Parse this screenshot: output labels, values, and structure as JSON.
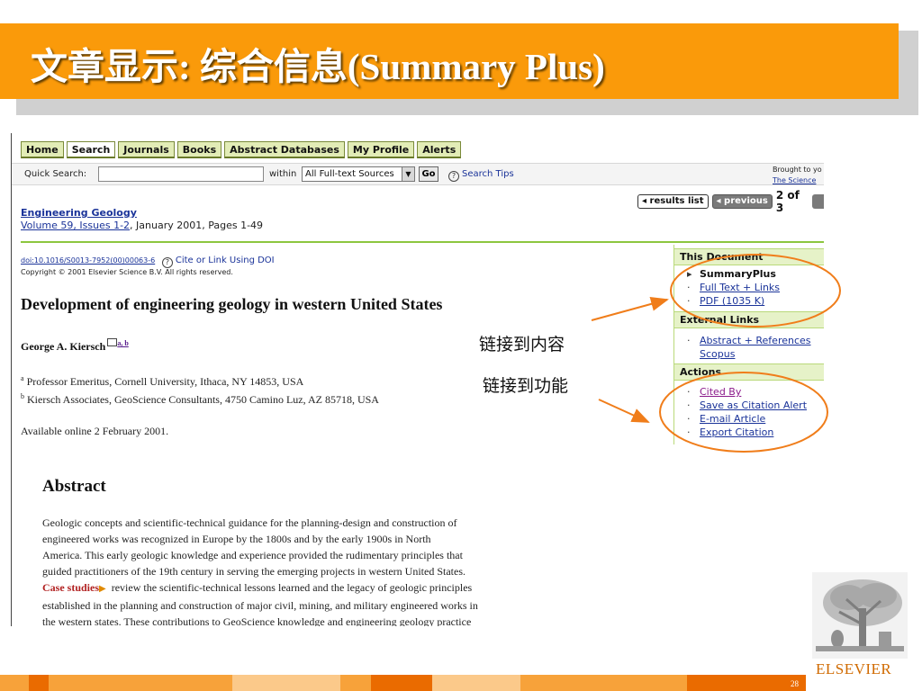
{
  "slide": {
    "title": "文章显示: 综合信息(Summary Plus)",
    "page_number": "28",
    "logo_text": "ELSEVIER"
  },
  "nav": {
    "tabs": [
      "Home",
      "Search",
      "Journals",
      "Books",
      "Abstract Databases",
      "My Profile",
      "Alerts"
    ]
  },
  "search": {
    "quick_label": "Quick Search:",
    "quick_value": "",
    "within_label": "within",
    "source_selected": "All Full-text Sources",
    "go_label": "Go",
    "tips_label": "Search Tips",
    "brought_line1": "Brought to yo",
    "brought_line2": "The Science"
  },
  "pager": {
    "results_list": "results list",
    "previous": "previous",
    "count": "2 of 3"
  },
  "article": {
    "journal": "Engineering Geology",
    "volume_link": "Volume 59, Issues 1-2",
    "volume_rest": ", January 2001, Pages 1-49",
    "doi": "doi:10.1016/S0013-7952(00)00063-6",
    "cite_doi": "Cite or Link Using DOI",
    "copyright": "Copyright © 2001 Elsevier Science B.V. All rights reserved.",
    "title": "Development of engineering geology in western United States",
    "author": "George A. Kiersch",
    "author_refs": "a, b",
    "affiliations": [
      {
        "sup": "a",
        "text": "Professor Emeritus, Cornell University, Ithaca, NY 14853, USA"
      },
      {
        "sup": "b",
        "text": "Kiersch Associates, GeoScience Consultants, 4750 Camino Luz, AZ 85718, USA"
      }
    ],
    "available": "Available online 2 February 2001.",
    "abstract_heading": "Abstract",
    "abstract_lines": [
      "Geologic concepts and scientific-technical guidance for the planning-design and construction of",
      "engineered works was recognized in Europe by the 1800s and by the early 1900s in North",
      "America. This early geologic knowledge and experience provided the rudimentary principles that",
      "guided practitioners of the 19th century in serving the emerging projects in western United States."
    ],
    "case_studies": "Case studies",
    "abstract_after": [
      " review the scientific-technical lessons learned and the legacy of geologic principles",
      "established in the planning and construction of major civil, mining, and military engineered works in",
      "the western states. These contributions to GeoScience knowledge and engineering geology practice"
    ]
  },
  "panel": {
    "this_document": "This Document",
    "summary_plus": "SummaryPlus",
    "full_text": "Full Text + Links",
    "pdf": "PDF (1035 K)",
    "external_links": "External Links",
    "abstract_refs": "Abstract + References",
    "scopus": "Scopus",
    "actions": "Actions",
    "cited_by": "Cited By",
    "save_alert": "Save as Citation Alert",
    "email_article": "E-mail Article",
    "export_citation": "Export Citation"
  },
  "annotations": {
    "content_link": "链接到内容",
    "function_link": "链接到功能"
  },
  "colors": {
    "title_bar": "#fa9a0a",
    "annotation": "#f07d1a",
    "link": "#1a3399"
  }
}
